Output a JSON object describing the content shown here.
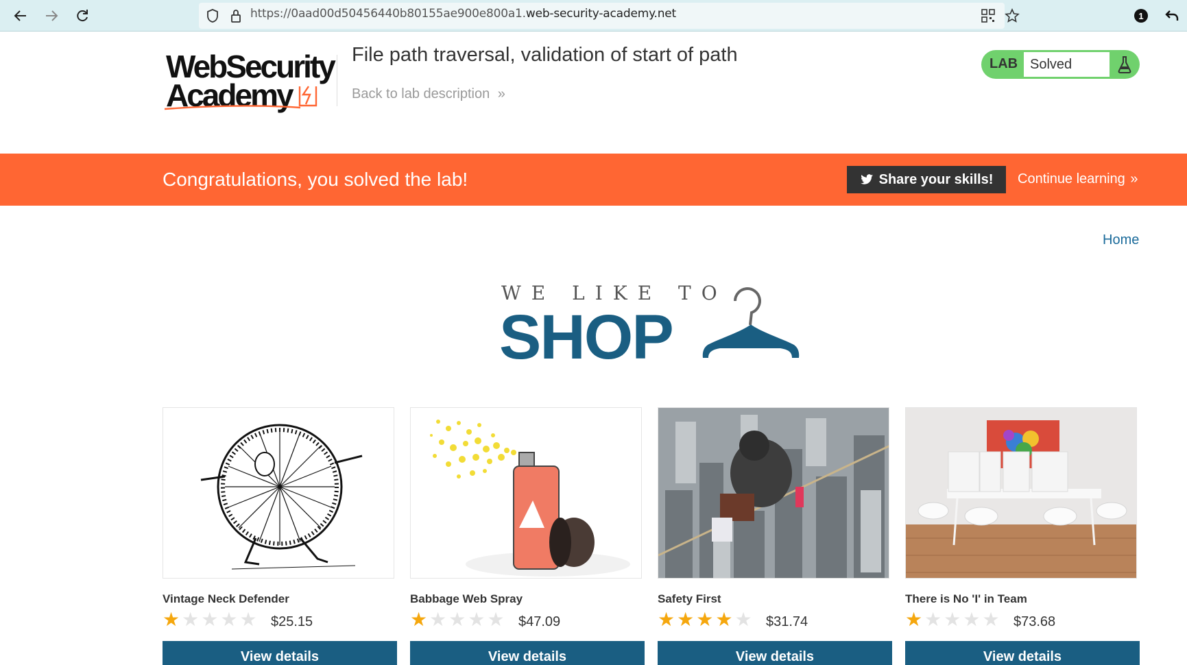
{
  "browser": {
    "url_prefix": "https://0aad00d50456440b80155ae900e800a1.",
    "url_domain": "web-security-academy.net",
    "notification_count": "1"
  },
  "header": {
    "logo_line1": "WebSecurity",
    "logo_line2": "Academy",
    "lab_title": "File path traversal, validation of start of path",
    "back_link": "Back to lab description",
    "lab_badge_label": "LAB",
    "lab_status": "Solved"
  },
  "banner": {
    "message": "Congratulations, you solved the lab!",
    "share_label": "Share your skills!",
    "continue_label": "Continue learning"
  },
  "nav": {
    "home": "Home"
  },
  "shop_logo": {
    "tagline": "WE LIKE TO",
    "big": "SHOP"
  },
  "products": [
    {
      "name": "Vintage Neck Defender",
      "price": "$25.15",
      "rating": 1,
      "button": "View details"
    },
    {
      "name": "Babbage Web Spray",
      "price": "$47.09",
      "rating": 1,
      "button": "View details"
    },
    {
      "name": "Safety First",
      "price": "$31.74",
      "rating": 4,
      "button": "View details"
    },
    {
      "name": "There is No 'I' in Team",
      "price": "$73.68",
      "rating": 1,
      "button": "View details"
    }
  ],
  "colors": {
    "banner": "#ff6633",
    "primary": "#1a5e82",
    "lab_badge": "#70d16d",
    "star": "#f5a70e"
  }
}
